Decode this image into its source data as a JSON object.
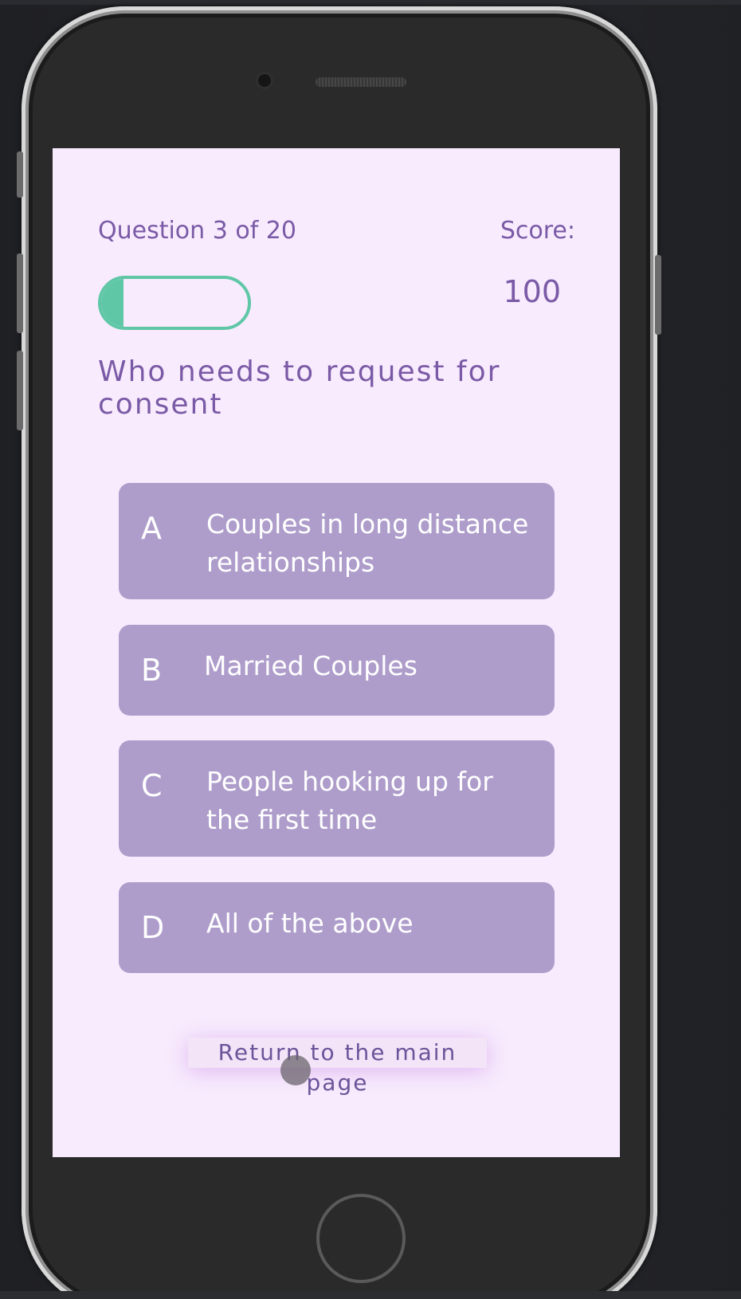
{
  "quiz": {
    "question_counter": "Question 3 of 20",
    "score_label": "Score:",
    "score_value": "100",
    "progress_fraction": 0.15,
    "question_text": "Who needs to request for consent",
    "options": [
      {
        "letter": "A",
        "text": "Couples in long distance relationships"
      },
      {
        "letter": "B",
        "text": "Married Couples"
      },
      {
        "letter": "C",
        "text": "People hooking up for the first time"
      },
      {
        "letter": "D",
        "text": "All of the above"
      }
    ],
    "return_label": "Return to the main page"
  },
  "colors": {
    "screen_bg": "#f8ebfd",
    "accent_purple": "#7a5aa6",
    "option_bg": "#ae9dcb",
    "progress_green": "#5fc7a6"
  }
}
